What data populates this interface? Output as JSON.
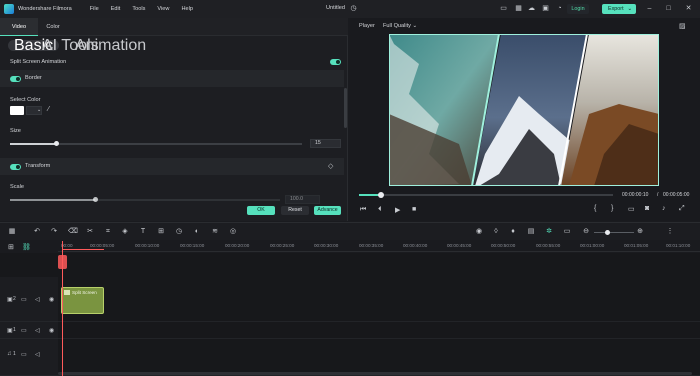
{
  "app": {
    "name": "Wondershare Filmora",
    "menu": [
      "File",
      "Edit",
      "Tools",
      "View",
      "Help"
    ],
    "title": "Untitled",
    "login_label": "Login",
    "export_label": "Export"
  },
  "left_panel": {
    "tabs": [
      "Video",
      "Color"
    ],
    "active_tab": "Video",
    "subtabs": [
      "Basic",
      "AI Tools",
      "Animation"
    ],
    "active_subtab": "Basic",
    "split_screen_label": "Split Screen Animation",
    "border_label": "Border",
    "select_color_label": "Select Color",
    "size_label": "Size",
    "size_value": "15",
    "transform_label": "Transform",
    "scale_label": "Scale",
    "scale_value": "100.0",
    "ok_label": "OK",
    "reset_label": "Reset",
    "advance_label": "Advance"
  },
  "player": {
    "label": "Player",
    "quality": "Full Quality",
    "current_time": "00:00:00:10",
    "total_time": "00:00:05:00",
    "time_separator": "/"
  },
  "timeline": {
    "ruler": [
      "00:00",
      "00:00:05:00",
      "00:00:10:00",
      "00:00:15:00",
      "00:00:20:00",
      "00:00:25:00",
      "00:00:30:00",
      "00:00:35:00",
      "00:00:40:00",
      "00:00:45:00",
      "00:00:50:00",
      "00:00:55:00",
      "00:01:00:00",
      "00:01:05:00",
      "00:01:10:00"
    ],
    "clip_label": "Split Screen",
    "tracks": [
      "2",
      "1",
      "1"
    ]
  },
  "colors": {
    "accent": "#56e1bd",
    "clip": "#7a9440",
    "playhead": "#ff5b5b"
  }
}
